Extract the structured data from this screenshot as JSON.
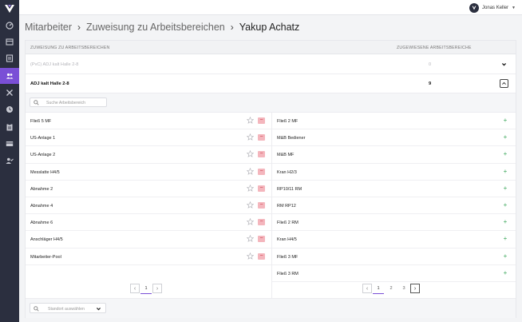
{
  "sidebar": {
    "logo_icon": "logo-icon",
    "items": [
      {
        "icon": "dashboard-icon"
      },
      {
        "icon": "calendar-icon"
      },
      {
        "icon": "document-icon"
      },
      {
        "icon": "users-icon",
        "active": true
      },
      {
        "icon": "tools-icon"
      },
      {
        "icon": "clock-icon"
      },
      {
        "icon": "clipboard-icon"
      },
      {
        "icon": "id-card-icon"
      },
      {
        "icon": "user-check-icon"
      }
    ]
  },
  "topbar": {
    "user_name": "Jonas Keller"
  },
  "breadcrumb": [
    "Mitarbeiter",
    "Zuweisung zu Arbeitsbereichen",
    "Yakup Achatz"
  ],
  "table": {
    "col1": "ZUWEISUNG ZU ARBEITSBEREICHEN",
    "col2": "ZUGEWIESENE ARBEITSBEREICHE",
    "row1": {
      "label": "(PvC) ADJ kalt Halle 2-8",
      "count": "0"
    },
    "row2": {
      "label": "ADJ kalt Halle 2-8",
      "count": "9"
    }
  },
  "search": {
    "placeholder": "Suche Arbeitsbereich"
  },
  "assigned": [
    "Fließ 5 MF",
    "US-Anlage 1",
    "US-Anlage 2",
    "Messlatte H4/5",
    "Abnahme 2",
    "Abnahme 4",
    "Abnahme 6",
    "Anschläger H4/5",
    "Mitarbeiter-Pool"
  ],
  "available": [
    "Fließ 2 MF",
    "M&B Bediener",
    "M&B MF",
    "Kran H2/3",
    "RP10/11 RM",
    "RM RP12",
    "Fließ 2 RM",
    "Kran H4/5",
    "Fließ 3 MF",
    "Fließ 3 RM"
  ],
  "pager_left": {
    "pages": [
      "1"
    ],
    "active": "1"
  },
  "pager_right": {
    "pages": [
      "1",
      "2",
      "3"
    ],
    "active": "1"
  },
  "footer": {
    "select_placeholder": "Standort auswählen"
  },
  "colors": {
    "accent": "#7a4fd6",
    "sidebar": "#2b2f3f",
    "remove": "#f4b6bd",
    "add": "#3aa65a"
  }
}
